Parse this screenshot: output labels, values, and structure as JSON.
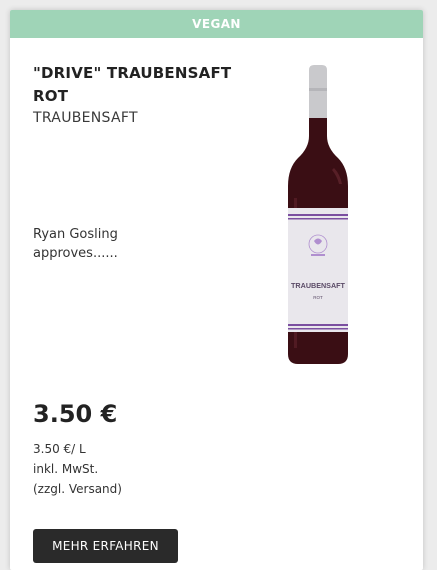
{
  "product": {
    "badge": "VEGAN",
    "title": "\"DRIVE\" TRAUBENSAFT ROT",
    "subtitle": "TRAUBENSAFT",
    "description": "Ryan Gosling approves......",
    "price": "3.50 €",
    "unit_price": "3.50 €/ L",
    "tax_note": "inkl. MwSt.",
    "shipping_note": "(zzgl. Versand)",
    "cta_label": "MEHR ERFAHREN",
    "image": {
      "icon": "wine-bottle-icon",
      "label_main": "TRAUBENSAFT",
      "label_sub": "ROT"
    }
  },
  "colors": {
    "badge_bg": "#9fd4b7",
    "button_bg": "#2a2a2a",
    "bottle": "#3a0e14",
    "label_stripe": "#7b4fa0"
  }
}
